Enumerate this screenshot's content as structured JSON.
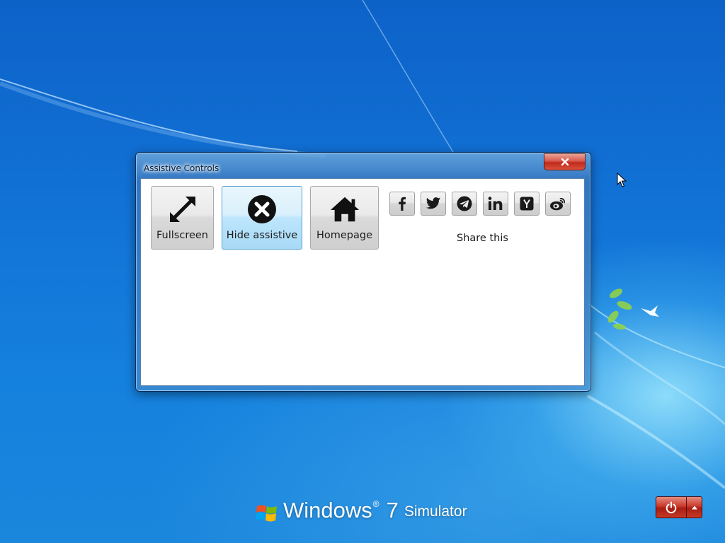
{
  "window": {
    "title": "Assistive Controls"
  },
  "controls": [
    {
      "label": "Fullscreen",
      "icon": "expand-arrows-icon",
      "active": false
    },
    {
      "label": "Hide assistive",
      "icon": "close-circle-icon",
      "active": true
    },
    {
      "label": "Homepage",
      "icon": "home-icon",
      "active": false
    }
  ],
  "share": {
    "label": "Share this",
    "networks": [
      "facebook-icon",
      "twitter-icon",
      "telegram-icon",
      "linkedin-icon",
      "hacker-news-icon",
      "weibo-icon"
    ]
  },
  "branding": {
    "word": "Windows",
    "registered": "®",
    "version": "7",
    "suffix": "Simulator"
  },
  "colors": {
    "desktop_blue": "#1273d6",
    "close_red": "#c1291b",
    "active_button": "#bee6fd"
  }
}
